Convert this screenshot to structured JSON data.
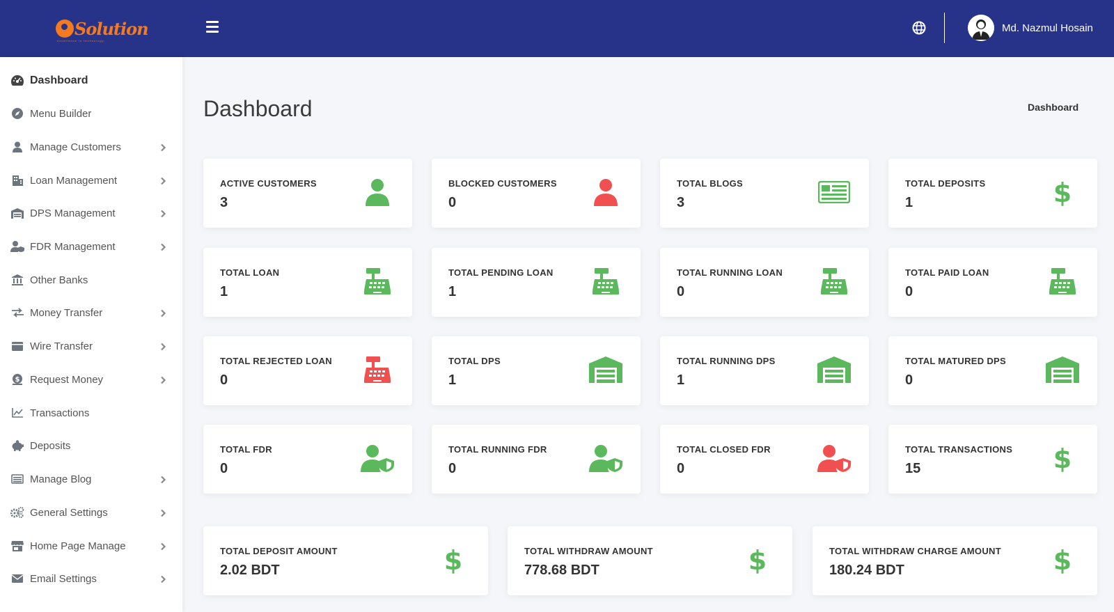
{
  "header": {
    "logo_text": "Solution",
    "logo_sub": "excellence in technology",
    "user_name": "Md. Nazmul Hosain"
  },
  "sidebar": {
    "items": [
      {
        "label": "Dashboard",
        "icon": "dashboard-icon",
        "expandable": false
      },
      {
        "label": "Menu Builder",
        "icon": "compass-icon",
        "expandable": false
      },
      {
        "label": "Manage Customers",
        "icon": "user-icon",
        "expandable": true
      },
      {
        "label": "Loan Management",
        "icon": "building-icon",
        "expandable": true
      },
      {
        "label": "DPS Management",
        "icon": "warehouse-icon",
        "expandable": true
      },
      {
        "label": "FDR Management",
        "icon": "user-shield-icon",
        "expandable": true
      },
      {
        "label": "Other Banks",
        "icon": "bank-icon",
        "expandable": false
      },
      {
        "label": "Money Transfer",
        "icon": "exchange-icon",
        "expandable": true
      },
      {
        "label": "Wire Transfer",
        "icon": "wallet-icon",
        "expandable": true
      },
      {
        "label": "Request Money",
        "icon": "money-request-icon",
        "expandable": true
      },
      {
        "label": "Transactions",
        "icon": "chart-line-icon",
        "expandable": false
      },
      {
        "label": "Deposits",
        "icon": "piggy-bank-icon",
        "expandable": false
      },
      {
        "label": "Manage Blog",
        "icon": "newspaper-icon",
        "expandable": true
      },
      {
        "label": "General Settings",
        "icon": "cogs-icon",
        "expandable": true
      },
      {
        "label": "Home Page Manage",
        "icon": "store-icon",
        "expandable": true
      },
      {
        "label": "Email Settings",
        "icon": "envelope-icon",
        "expandable": true
      }
    ]
  },
  "main": {
    "title": "Dashboard",
    "breadcrumb": "Dashboard"
  },
  "cards": [
    {
      "label": "ACTIVE CUSTOMERS",
      "value": "3",
      "icon": "user-icon",
      "color": "#5cb85c"
    },
    {
      "label": "BLOCKED CUSTOMERS",
      "value": "0",
      "icon": "user-icon",
      "color": "#f05050"
    },
    {
      "label": "TOTAL BLOGS",
      "value": "3",
      "icon": "newspaper-icon",
      "color": "#5cb85c"
    },
    {
      "label": "TOTAL DEPOSITS",
      "value": "1",
      "icon": "dollar-icon",
      "color": "#5cb85c"
    },
    {
      "label": "TOTAL LOAN",
      "value": "1",
      "icon": "cash-register-icon",
      "color": "#5cb85c"
    },
    {
      "label": "TOTAL PENDING LOAN",
      "value": "1",
      "icon": "cash-register-icon",
      "color": "#5cb85c"
    },
    {
      "label": "TOTAL RUNNING LOAN",
      "value": "0",
      "icon": "cash-register-icon",
      "color": "#5cb85c"
    },
    {
      "label": "TOTAL PAID LOAN",
      "value": "0",
      "icon": "cash-register-icon",
      "color": "#5cb85c"
    },
    {
      "label": "TOTAL REJECTED LOAN",
      "value": "0",
      "icon": "cash-register-icon",
      "color": "#f05050"
    },
    {
      "label": "TOTAL DPS",
      "value": "1",
      "icon": "warehouse-icon",
      "color": "#5cb85c"
    },
    {
      "label": "TOTAL RUNNING DPS",
      "value": "1",
      "icon": "warehouse-icon",
      "color": "#5cb85c"
    },
    {
      "label": "TOTAL MATURED DPS",
      "value": "0",
      "icon": "warehouse-icon",
      "color": "#5cb85c"
    },
    {
      "label": "TOTAL FDR",
      "value": "0",
      "icon": "user-shield-icon",
      "color": "#5cb85c"
    },
    {
      "label": "TOTAL RUNNING FDR",
      "value": "0",
      "icon": "user-shield-icon",
      "color": "#5cb85c"
    },
    {
      "label": "TOTAL CLOSED FDR",
      "value": "0",
      "icon": "user-shield-icon",
      "color": "#f05050"
    },
    {
      "label": "TOTAL TRANSACTIONS",
      "value": "15",
      "icon": "dollar-icon",
      "color": "#5cb85c"
    }
  ],
  "amount_cards": [
    {
      "label": "TOTAL DEPOSIT AMOUNT",
      "value": "2.02 BDT",
      "icon": "dollar-icon",
      "color": "#5cb85c"
    },
    {
      "label": "TOTAL WITHDRAW AMOUNT",
      "value": "778.68 BDT",
      "icon": "dollar-icon",
      "color": "#5cb85c"
    },
    {
      "label": "TOTAL WITHDRAW CHARGE AMOUNT",
      "value": "180.24 BDT",
      "icon": "dollar-icon",
      "color": "#5cb85c"
    }
  ],
  "colors": {
    "header_bg": "#263388",
    "green": "#5cb85c",
    "red": "#f05050",
    "logo_orange": "#f47a20"
  }
}
